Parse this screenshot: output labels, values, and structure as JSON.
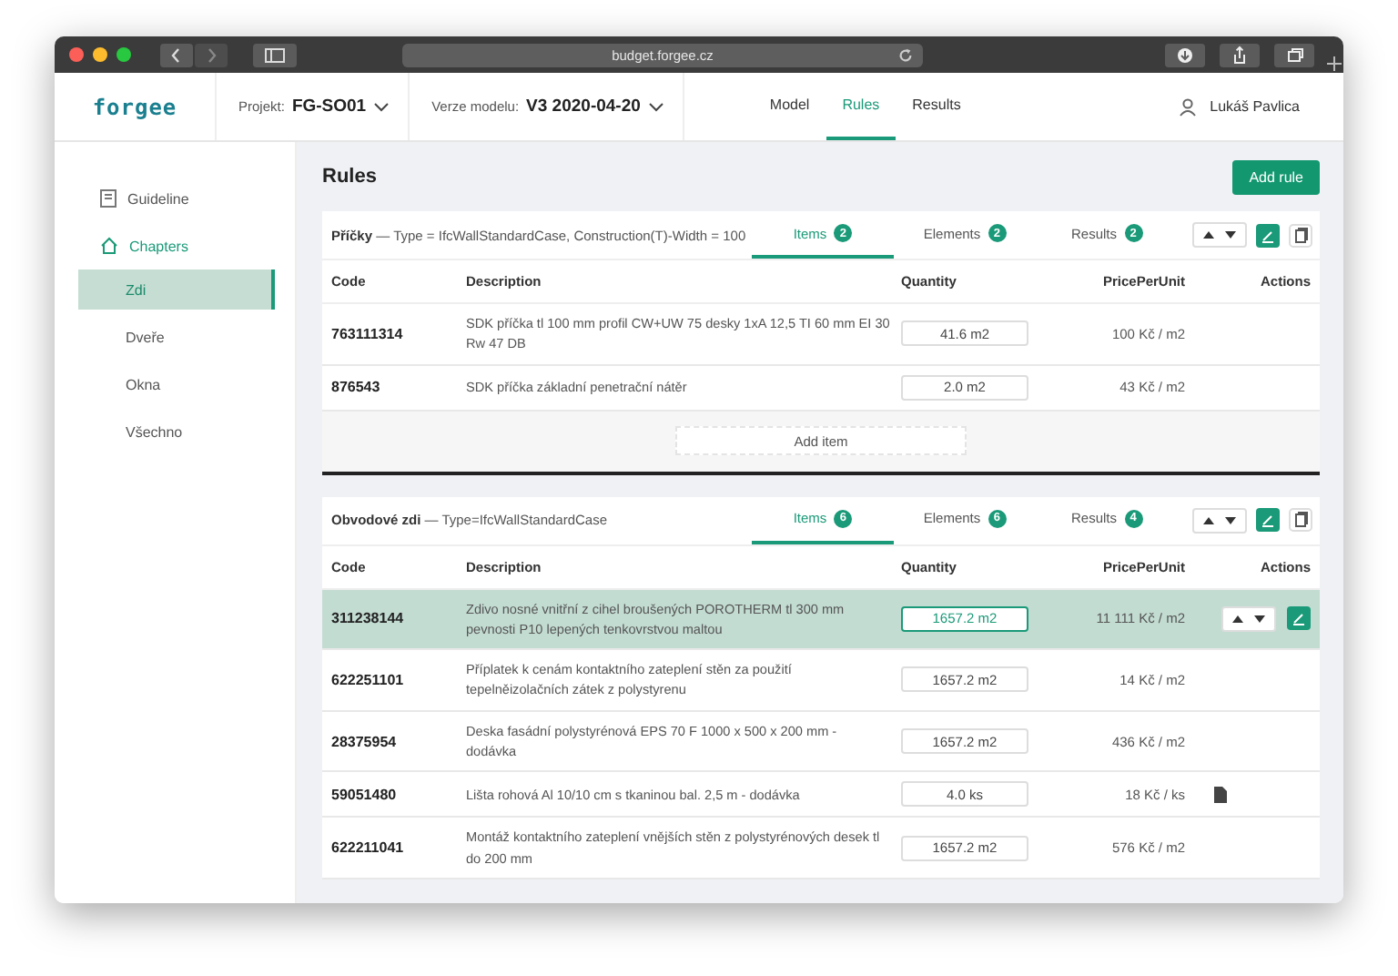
{
  "browser": {
    "url": "budget.forgee.cz"
  },
  "header": {
    "logo": "forgee",
    "project": {
      "label": "Projekt:",
      "value": "FG-SO01"
    },
    "model_version": {
      "label": "Verze modelu:",
      "value": "V3 2020-04-20"
    },
    "nav": [
      {
        "label": "Model",
        "selected": false
      },
      {
        "label": "Rules",
        "selected": true
      },
      {
        "label": "Results",
        "selected": false
      }
    ],
    "user": "Lukáš Pavlica"
  },
  "sidebar": {
    "items": [
      {
        "label": "Guideline",
        "kind": "guideline"
      },
      {
        "label": "Chapters",
        "kind": "chapters",
        "children": [
          {
            "label": "Zdi",
            "selected": true
          },
          {
            "label": "Dveře",
            "selected": false
          },
          {
            "label": "Okna",
            "selected": false
          },
          {
            "label": "Všechno",
            "selected": false
          }
        ]
      }
    ]
  },
  "page": {
    "title": "Rules",
    "add_button": "Add rule"
  },
  "rules": [
    {
      "name": "Příčky",
      "condition": "— Type = IfcWallStandardCase, Construction(T)-Width = 100",
      "tabs": [
        {
          "label": "Items",
          "count": "2",
          "selected": true
        },
        {
          "label": "Elements",
          "count": "2",
          "selected": false
        },
        {
          "label": "Results",
          "count": "2",
          "selected": false
        }
      ],
      "columns": [
        "Code",
        "Description",
        "Quantity",
        "PricePerUnit",
        "Actions"
      ],
      "rows": [
        {
          "code": "763111314",
          "description": "SDK příčka tl 100 mm profil CW+UW 75 desky 1xA 12,5 TI 60 mm EI 30 Rw 47 DB",
          "quantity": "41.6 m2",
          "price": "100 Kč /  m2",
          "selected": false,
          "kind": "plain"
        },
        {
          "code": "876543",
          "description": "SDK příčka základní penetrační nátěr",
          "quantity": "2.0 m2",
          "price": "43 Kč /  m2",
          "selected": false,
          "kind": "plain"
        }
      ],
      "add_item": "Add item"
    },
    {
      "name": "Obvodové zdi",
      "condition": "— Type=IfcWallStandardCase",
      "tabs": [
        {
          "label": "Items",
          "count": "6",
          "selected": true
        },
        {
          "label": "Elements",
          "count": "6",
          "selected": false
        },
        {
          "label": "Results",
          "count": "4",
          "selected": false
        }
      ],
      "columns": [
        "Code",
        "Description",
        "Quantity",
        "PricePerUnit",
        "Actions"
      ],
      "rows": [
        {
          "code": "311238144",
          "description": "Zdivo nosné vnitřní z cihel broušených POROTHERM tl 300 mm pevnosti P10 lepených tenkovrstvou maltou",
          "quantity": "1657.2 m2",
          "price": "11 111 Kč /  m2",
          "selected": true,
          "kind": "editable"
        },
        {
          "code": "622251101",
          "description": "Příplatek k cenám kontaktního zateplení stěn za použití tepelněizolačních zátek z polystyrenu",
          "quantity": "1657.2 m2",
          "price": "14 Kč /  m2",
          "selected": false,
          "kind": "plain"
        },
        {
          "code": "28375954",
          "description": "Deska fasádní polystyrénová EPS 70 F 1000 x 500 x 200 mm - dodávka",
          "quantity": "1657.2 m2",
          "price": "436 Kč /  m2",
          "selected": false,
          "kind": "plain"
        },
        {
          "code": "59051480",
          "description": "Lišta rohová Al 10/10 cm s tkaninou bal. 2,5 m - dodávka",
          "quantity": "4.0 ks",
          "price": "18 Kč /  ks",
          "selected": false,
          "kind": "attachment"
        },
        {
          "code": "622211041",
          "description": "Montáž kontaktního zateplení vnějších stěn z polystyrénových desek tl do 200 mm",
          "quantity": "1657.2 m2",
          "price": "576 Kč /  m2",
          "selected": false,
          "kind": "plain"
        }
      ]
    }
  ]
}
